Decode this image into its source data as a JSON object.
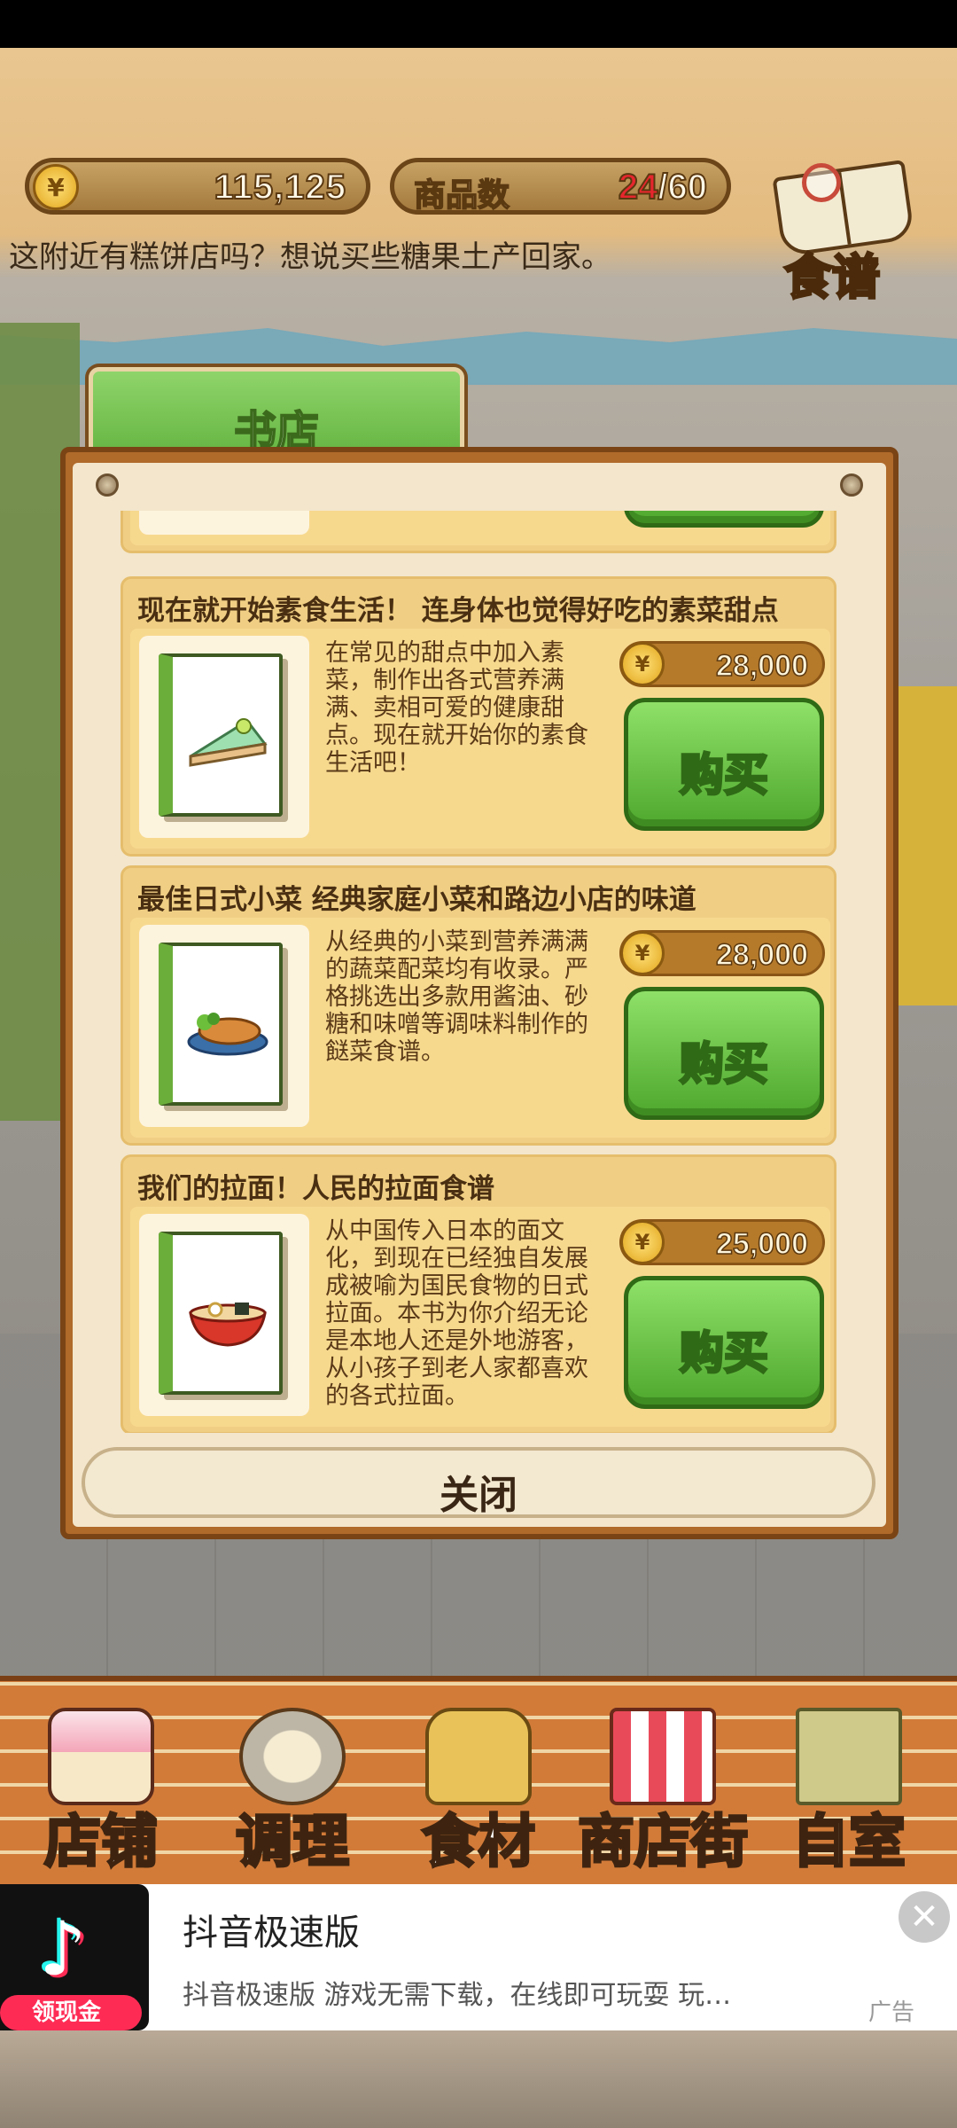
{
  "hud": {
    "coins": "115,125",
    "coin_symbol": "¥",
    "goods_label": "商品数",
    "goods_current": "24",
    "goods_total": "/60",
    "recipe_label": "食谱"
  },
  "dialog": "这附近有糕饼店吗？想说买些糖果土产回家。",
  "shop": {
    "tab_label": "书店",
    "close_label": "关闭",
    "buy_label": "购买",
    "items": [
      {
        "title": "现在就开始素食生活！ 连身体也觉得好吃的素菜甜点",
        "desc": "在常见的甜点中加入素菜，制作出各式营养满满、卖相可爱的健康甜点。现在就开始你的素食生活吧！",
        "price": "28,000",
        "dish_icon": "cake-slice-icon"
      },
      {
        "title": "最佳日式小菜 经典家庭小菜和路边小店的味道",
        "desc": "从经典的小菜到营养满满的蔬菜配菜均有收录。严格挑选出多款用酱油、砂糖和味噌等调味料制作的餸菜食谱。",
        "price": "28,000",
        "dish_icon": "grilled-fish-icon"
      },
      {
        "title": "我们的拉面！人民的拉面食谱",
        "desc": "从中国传入日本的面文化，到现在已经独自发展成被喻为国民食物的日式拉面。本书为你介绍无论是本地人还是外地游客，从小孩子到老人家都喜欢的各式拉面。",
        "price": "25,000",
        "dish_icon": "ramen-bowl-icon"
      }
    ]
  },
  "nav": {
    "items": [
      {
        "label": "店铺",
        "icon": "cake-icon"
      },
      {
        "label": "调理",
        "icon": "mixing-bowl-icon"
      },
      {
        "label": "食材",
        "icon": "flour-sack-icon"
      },
      {
        "label": "商店街",
        "icon": "shop-icon"
      },
      {
        "label": "自室",
        "icon": "staff-sign-icon"
      }
    ]
  },
  "ad": {
    "title": "抖音极速版",
    "desc": "抖音极速版 游戏无需下载，在线即可玩耍 玩…",
    "badge": "领现金",
    "tag": "广告",
    "close_symbol": "✕"
  }
}
